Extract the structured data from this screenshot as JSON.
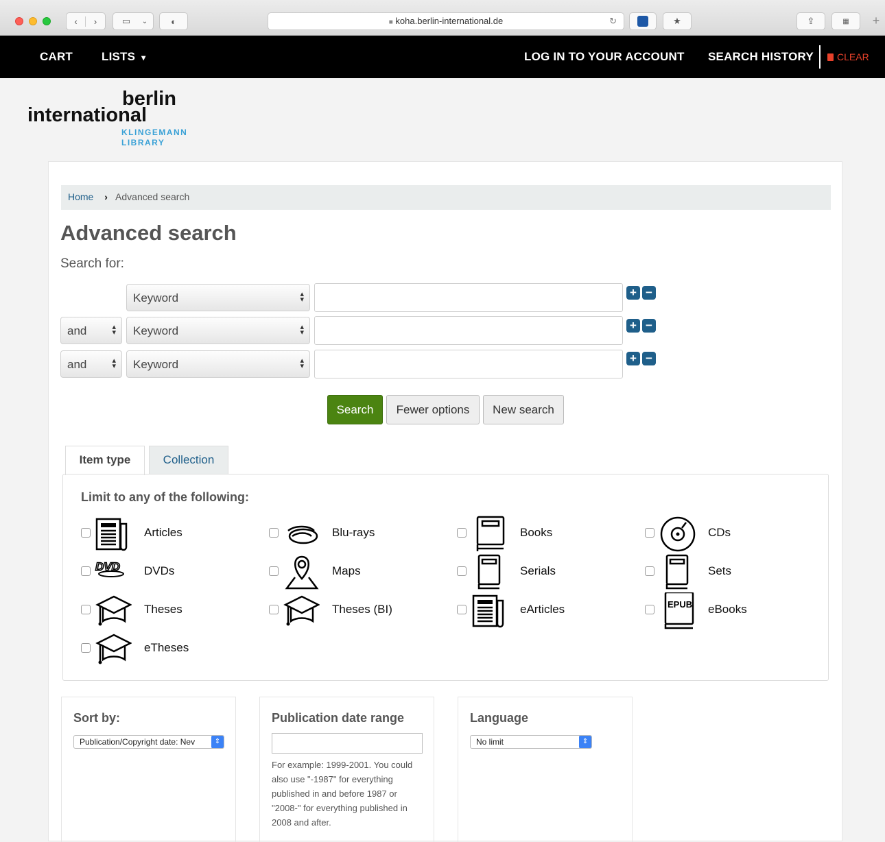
{
  "browser": {
    "url": "koha.berlin-international.de"
  },
  "nav": {
    "cart": "CART",
    "lists": "LISTS",
    "lists_caret": "▾",
    "login": "LOG IN TO YOUR ACCOUNT",
    "history": "SEARCH HISTORY",
    "clear": "CLEAR"
  },
  "logo": {
    "line1": "berlin",
    "line2": "international",
    "line3": "KLINGEMANN",
    "line4": "LIBRARY"
  },
  "breadcrumb": {
    "home": "Home",
    "sep": "›",
    "current": "Advanced search"
  },
  "page_title": "Advanced search",
  "search_for": "Search for:",
  "search_rows": [
    {
      "operator": "",
      "field": "Keyword",
      "value": ""
    },
    {
      "operator": "and",
      "field": "Keyword",
      "value": ""
    },
    {
      "operator": "and",
      "field": "Keyword",
      "value": ""
    }
  ],
  "buttons": {
    "search": "Search",
    "fewer": "Fewer options",
    "new": "New search"
  },
  "tabs": {
    "item_type": "Item type",
    "collection": "Collection"
  },
  "limit_title": "Limit to any of the following:",
  "item_types": [
    {
      "label": "Articles",
      "icon": "newspaper-icon"
    },
    {
      "label": "Blu-rays",
      "icon": "bluray-icon"
    },
    {
      "label": "Books",
      "icon": "book-icon"
    },
    {
      "label": "CDs",
      "icon": "cd-icon"
    },
    {
      "label": "DVDs",
      "icon": "dvd-icon"
    },
    {
      "label": "Maps",
      "icon": "map-icon"
    },
    {
      "label": "Serials",
      "icon": "book-icon"
    },
    {
      "label": "Sets",
      "icon": "book-icon"
    },
    {
      "label": "Theses",
      "icon": "graduation-cap-icon"
    },
    {
      "label": "Theses (BI)",
      "icon": "graduation-cap-icon"
    },
    {
      "label": "eArticles",
      "icon": "newspaper-icon"
    },
    {
      "label": "eBooks",
      "icon": "epub-icon"
    },
    {
      "label": "eTheses",
      "icon": "graduation-cap-icon"
    }
  ],
  "sort": {
    "title": "Sort by:",
    "value": "Publication/Copyright date: Nev"
  },
  "pubdate": {
    "title": "Publication date range",
    "value": "",
    "help": "For example: 1999-2001. You could also use \"-1987\" for everything published in and before 1987 or \"2008-\" for everything published in 2008 and after."
  },
  "language": {
    "title": "Language",
    "value": "No limit"
  },
  "dvd_logo_text": "DVD",
  "epub_text": "EPUB"
}
